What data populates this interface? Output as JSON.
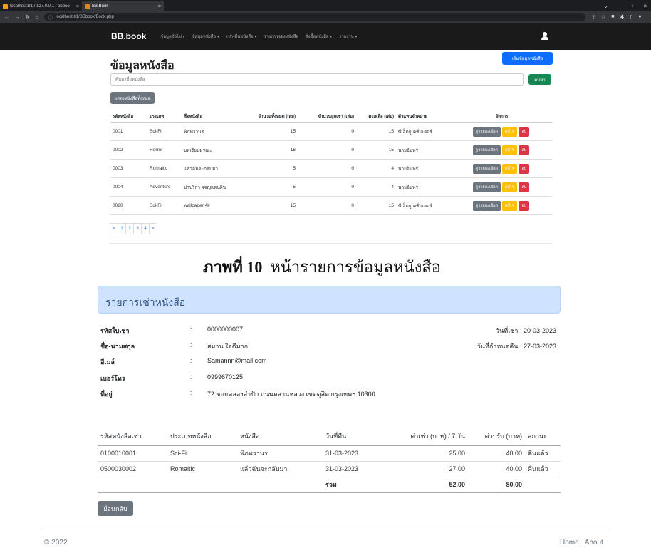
{
  "browser": {
    "tabs": [
      {
        "title": "localhost:81 / 127.0.0.1 / bbboo"
      },
      {
        "title": "BB.Book"
      }
    ],
    "url": "localhost:81/BBbook/Book.php"
  },
  "navbar": {
    "brand": "BB.book",
    "links": [
      "ข้อมูลทั่วไป ▾",
      "ข้อมูลหนังสือ ▾",
      "เช่า-คืนหนังสือ ▾",
      "รายการจองหนังสือ",
      "สั่งซื้อหนังสือ ▾",
      "รายงาน ▾"
    ]
  },
  "books_page": {
    "title": "ข้อมูลหนังสือ",
    "add_button": "เพิ่มข้อมูลหนังสือ",
    "search_placeholder": "ค้นหาชื่อหนังสือ",
    "search_button": "ค้นหา",
    "show_all_button": "แสดงหนังสือทั้งหมด",
    "columns": [
      "รหัสหนังสือ",
      "ประเภท",
      "ชื่อหนังสือ",
      "จำนวนทั้งหมด (เล่ม)",
      "จำนวนถูกเช่า (เล่ม)",
      "คงเหลือ (เล่ม)",
      "ตัวแทนจำหน่าย",
      "จัดการ"
    ],
    "rows": [
      {
        "id": "0001",
        "type": "Sci-Fi",
        "name": "พิภพวานร",
        "total": "15",
        "rented": "0",
        "remain": "15",
        "dealer": "ซีเอ็ดยูเคชั่นเดอร์"
      },
      {
        "id": "0002",
        "type": "Horror",
        "name": "บทเรียนมรณะ",
        "total": "16",
        "rented": "0",
        "remain": "15",
        "dealer": "นายอินทร์"
      },
      {
        "id": "0003",
        "type": "Romaitic",
        "name": "แล้วฉันจะกลับมา",
        "total": "5",
        "rented": "0",
        "remain": "4",
        "dealer": "นายอินทร์"
      },
      {
        "id": "0004",
        "type": "Adventure",
        "name": "ปาปริกา ผจญแดนฝัน",
        "total": "5",
        "rented": "0",
        "remain": "4",
        "dealer": "นายอินทร์"
      },
      {
        "id": "0020",
        "type": "Sci-Fi",
        "name": "wallpaper 4k",
        "total": "15",
        "rented": "0",
        "remain": "15",
        "dealer": "ซีเอ็ดยูเคชั่นเดอร์"
      }
    ],
    "action_labels": {
      "detail": "ดูรายละเอียด",
      "edit": "แก้ไข",
      "delete": "ลบ"
    },
    "pagination": [
      "«",
      "1",
      "2",
      "3",
      "4",
      "»"
    ]
  },
  "caption": {
    "bold": "ภาพที่ 10",
    "text": "หน้ารายการข้อมูลหนังสือ"
  },
  "rental": {
    "heading": "รายการเช่าหนังสือ",
    "fields": [
      {
        "label": "รหัสใบเช่า",
        "value": "0000000007"
      },
      {
        "label": "ชื่อ-นามสกุล",
        "value": "สมาน ใจดีมาก"
      },
      {
        "label": "อีเมล์",
        "value": "Samannn@mail.com"
      },
      {
        "label": "เบอร์โทร",
        "value": "0999670125"
      },
      {
        "label": "ที่อยู่",
        "value": "72 ซอยคลองลำปัก ถนนหลานหลวง เขตดุสิต กรุงเทพฯ 10300"
      }
    ],
    "colon": ":",
    "rent_date": "วันที่เช่า : 20-03-2023",
    "due_date": "วันที่กำหนดคืน : 27-03-2023",
    "columns": [
      "รหัสหนังสือเช่า",
      "ประเภทหนังสือ",
      "หนังสือ",
      "วันที่คืน",
      "ค่าเช่า (บาท) / 7 วัน",
      "ค่าปรับ (บาท)",
      "สถานะ"
    ],
    "rows": [
      {
        "code": "0100010001",
        "type": "Sci-Fi",
        "book": "พิภพวานร",
        "return_date": "31-03-2023",
        "fee": "25.00",
        "fine": "40.00",
        "status": "คืนแล้ว"
      },
      {
        "code": "0500030002",
        "type": "Romaitic",
        "book": "แล้วฉันจะกลับมา",
        "return_date": "31-03-2023",
        "fee": "27.00",
        "fine": "40.00",
        "status": "คืนแล้ว"
      }
    ],
    "total_label": "รวม",
    "total_fee": "52.00",
    "total_fine": "80.00",
    "back_button": "ย้อนกลับ"
  },
  "footer": {
    "copyright": "© 2022",
    "links": [
      "Home",
      "About"
    ]
  }
}
